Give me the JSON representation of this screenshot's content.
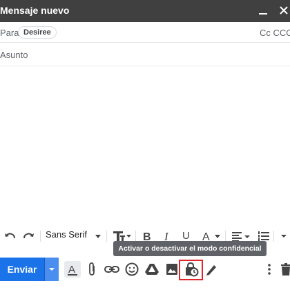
{
  "window": {
    "title": "Mensaje nuevo",
    "controls": [
      "minimize-icon",
      "close-icon"
    ]
  },
  "to": {
    "label": "Para",
    "recipient": "Desiree",
    "cc_bcc": "Cc CCO"
  },
  "subject": {
    "placeholder": "Asunto"
  },
  "formatting": {
    "font": "Sans Serif",
    "icons": [
      "undo-icon",
      "redo-icon",
      "font-size-icon",
      "bold-icon",
      "italic-icon",
      "underline-icon",
      "text-color-icon",
      "align-icon",
      "numbered-list-icon",
      "more-formatting-icon"
    ]
  },
  "tooltip": {
    "text": "Activar o desactivar el modo confidencial"
  },
  "bottom": {
    "send_label": "Enviar",
    "icons": [
      "formatting-options-icon",
      "attach-icon",
      "link-icon",
      "emoji-icon",
      "drive-icon",
      "photo-icon",
      "confidential-mode-icon",
      "signature-icon",
      "more-options-icon",
      "delete-icon"
    ]
  },
  "colors": {
    "titlebar": "#404040",
    "send_button": "#1a73e8",
    "tooltip": "#5f6368",
    "highlight": "#e0262b"
  }
}
